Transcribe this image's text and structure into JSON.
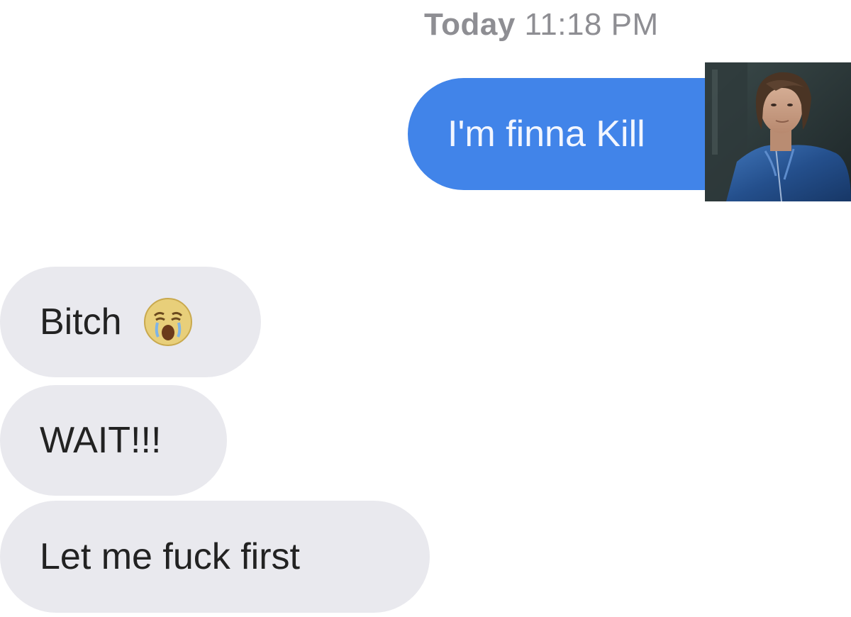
{
  "conversation": {
    "timestamp": {
      "day": "Today",
      "time": "11:18 PM"
    },
    "messages": [
      {
        "sender": "me",
        "text": "I'm finna Kill"
      },
      {
        "sender": "them",
        "text": "Bitch",
        "emoji": "crying-face-emoji"
      },
      {
        "sender": "them",
        "text": "WAIT!!!"
      },
      {
        "sender": "them",
        "text": "Let me fuck first"
      }
    ]
  },
  "overlay": {
    "image": "character-portrait",
    "colors": {
      "sent_bubble": "#4184e9",
      "received_bubble": "#e9e9ee",
      "timestamp": "#8e8e93"
    }
  }
}
